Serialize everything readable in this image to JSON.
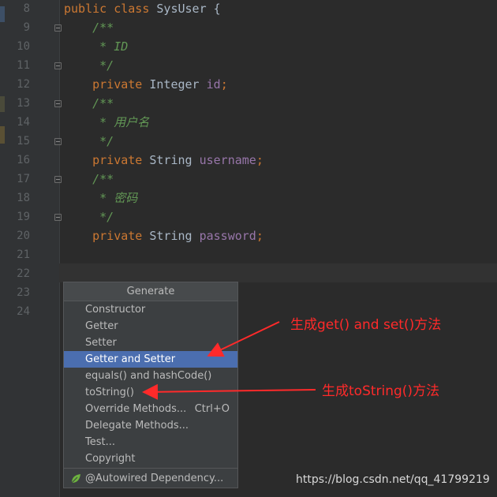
{
  "editor": {
    "lines": [
      {
        "n": "8",
        "parts": [
          [
            "kw",
            "public class "
          ],
          [
            "plain",
            "SysUser {"
          ]
        ]
      },
      {
        "n": "9",
        "parts": [
          [
            "cm",
            "    /**"
          ]
        ]
      },
      {
        "n": "10",
        "parts": [
          [
            "cm",
            "     * ID"
          ]
        ]
      },
      {
        "n": "11",
        "parts": [
          [
            "cm",
            "     */"
          ]
        ]
      },
      {
        "n": "12",
        "parts": [
          [
            "kw",
            "    private "
          ],
          [
            "plain",
            "Integer "
          ],
          [
            "fld",
            "id"
          ],
          [
            "semi",
            ";"
          ]
        ]
      },
      {
        "n": "13",
        "parts": [
          [
            "cm",
            "    /**"
          ]
        ]
      },
      {
        "n": "14",
        "parts": [
          [
            "cm",
            "     * 用户名"
          ]
        ]
      },
      {
        "n": "15",
        "parts": [
          [
            "cm",
            "     */"
          ]
        ]
      },
      {
        "n": "16",
        "parts": [
          [
            "kw",
            "    private "
          ],
          [
            "plain",
            "String "
          ],
          [
            "fld",
            "username"
          ],
          [
            "semi",
            ";"
          ]
        ]
      },
      {
        "n": "17",
        "parts": [
          [
            "cm",
            "    /**"
          ]
        ]
      },
      {
        "n": "18",
        "parts": [
          [
            "cm",
            "     * 密码"
          ]
        ]
      },
      {
        "n": "19",
        "parts": [
          [
            "cm",
            "     */"
          ]
        ]
      },
      {
        "n": "20",
        "parts": [
          [
            "kw",
            "    private "
          ],
          [
            "plain",
            "String "
          ],
          [
            "fld",
            "password"
          ],
          [
            "semi",
            ";"
          ]
        ]
      },
      {
        "n": "21",
        "parts": []
      },
      {
        "n": "22",
        "parts": []
      },
      {
        "n": "23",
        "parts": []
      },
      {
        "n": "24",
        "parts": []
      }
    ]
  },
  "generate_menu": {
    "title": "Generate",
    "items": [
      {
        "label": "Constructor",
        "shortcut": ""
      },
      {
        "label": "Getter",
        "shortcut": ""
      },
      {
        "label": "Setter",
        "shortcut": ""
      },
      {
        "label": "Getter and Setter",
        "shortcut": "",
        "selected": true
      },
      {
        "label": "equals() and hashCode()",
        "shortcut": ""
      },
      {
        "label": "toString()",
        "shortcut": ""
      },
      {
        "label": "Override Methods...",
        "shortcut": "Ctrl+O"
      },
      {
        "label": "Delegate Methods...",
        "shortcut": ""
      },
      {
        "label": "Test...",
        "shortcut": ""
      },
      {
        "label": "Copyright",
        "shortcut": ""
      }
    ],
    "footer_item": {
      "label": "@Autowired Dependency...",
      "icon": "spring-leaf-icon"
    }
  },
  "annotations": {
    "getter_setter": "生成get() and set()方法",
    "tostring": "生成toString()方法"
  },
  "watermark": "https://blog.csdn.net/qq_41799219",
  "colors": {
    "background": "#2b2b2b",
    "keyword": "#cc7832",
    "comment": "#629755",
    "field": "#9876aa",
    "selection": "#4b6eaf",
    "annotation": "#ff2a2a"
  }
}
